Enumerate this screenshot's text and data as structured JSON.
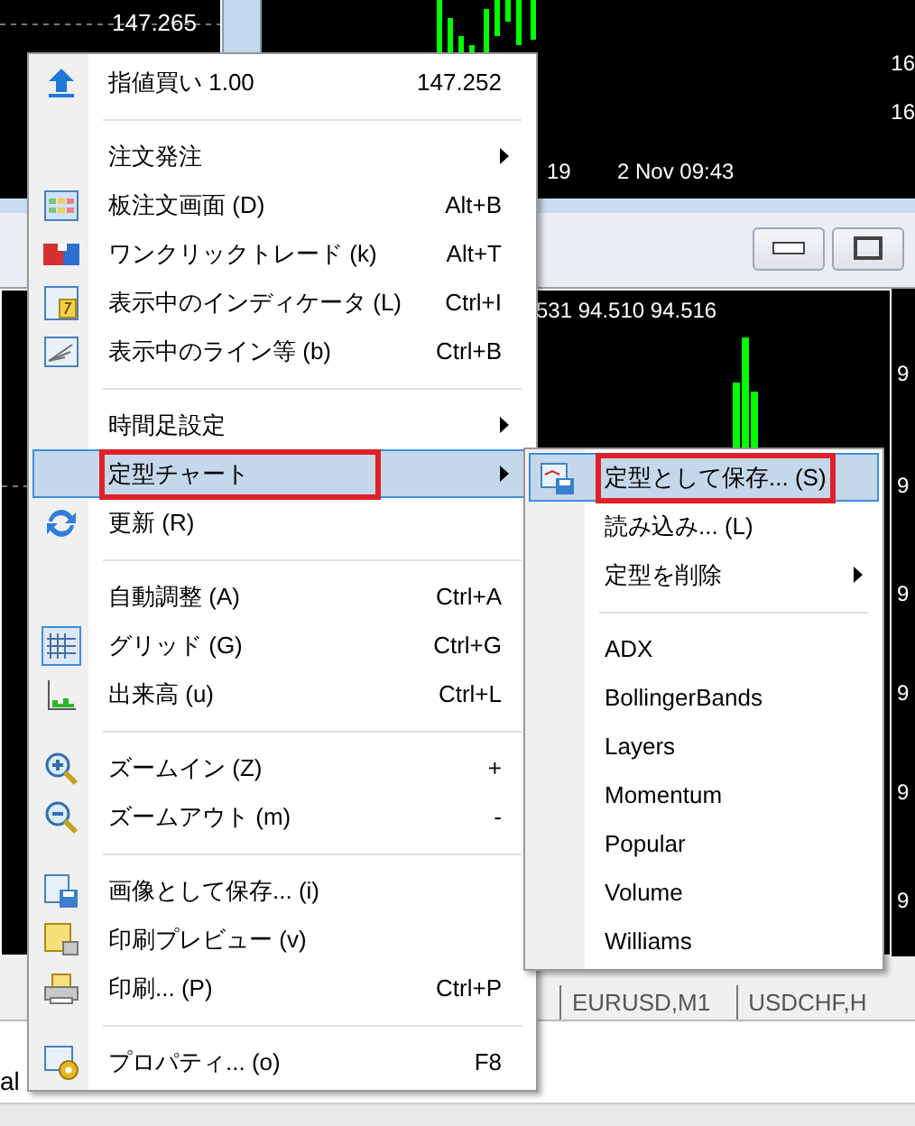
{
  "top_chart": {
    "price_label": "147.265",
    "time_labels": [
      "19",
      "2 Nov 09:43"
    ],
    "axis_labels": [
      "16",
      "16"
    ]
  },
  "lower_chart": {
    "header": "531 94.510 94.516",
    "axis_labels": [
      "9",
      "9",
      "9",
      "9",
      "9",
      "9"
    ]
  },
  "tabs": [
    {
      "label": "EURUSD,M1",
      "selected": false
    },
    {
      "label": "USDCHF,H",
      "selected": false
    }
  ],
  "status_text": "al",
  "context_menu": {
    "items": [
      {
        "kind": "item",
        "label": "指値買い 1.00",
        "shortcut": "147.252",
        "submenu": false,
        "selected": false,
        "checked": false,
        "highlighted": false
      },
      {
        "kind": "separator"
      },
      {
        "kind": "item",
        "label": "注文発注",
        "submenu": true,
        "selected": false,
        "checked": false,
        "highlighted": false
      },
      {
        "kind": "item",
        "label": "板注文画面 (D)",
        "shortcut": "Alt+B",
        "submenu": false,
        "selected": false,
        "checked": false,
        "highlighted": false
      },
      {
        "kind": "item",
        "label": "ワンクリックトレード (k)",
        "shortcut": "Alt+T",
        "submenu": false,
        "selected": false,
        "checked": false,
        "highlighted": false
      },
      {
        "kind": "item",
        "label": "表示中のインディケータ (L)",
        "shortcut": "Ctrl+I",
        "submenu": false,
        "selected": false,
        "checked": false,
        "highlighted": false
      },
      {
        "kind": "item",
        "label": "表示中のライン等 (b)",
        "shortcut": "Ctrl+B",
        "submenu": false,
        "selected": false,
        "checked": false,
        "highlighted": false
      },
      {
        "kind": "separator"
      },
      {
        "kind": "item",
        "label": "時間足設定",
        "submenu": true,
        "selected": false,
        "checked": false,
        "highlighted": false
      },
      {
        "kind": "item",
        "label": "定型チャート",
        "submenu": true,
        "selected": true,
        "checked": false,
        "highlighted": true
      },
      {
        "kind": "item",
        "label": "更新 (R)",
        "submenu": false,
        "selected": false,
        "checked": false,
        "highlighted": false
      },
      {
        "kind": "separator"
      },
      {
        "kind": "item",
        "label": "自動調整 (A)",
        "shortcut": "Ctrl+A",
        "submenu": false,
        "selected": false,
        "checked": false,
        "highlighted": false
      },
      {
        "kind": "item",
        "label": "グリッド (G)",
        "shortcut": "Ctrl+G",
        "submenu": false,
        "selected": false,
        "checked": true,
        "highlighted": false
      },
      {
        "kind": "item",
        "label": "出来高 (u)",
        "shortcut": "Ctrl+L",
        "submenu": false,
        "selected": false,
        "checked": false,
        "highlighted": false
      },
      {
        "kind": "separator"
      },
      {
        "kind": "item",
        "label": "ズームイン (Z)",
        "shortcut": "+",
        "submenu": false,
        "selected": false,
        "checked": false,
        "highlighted": false
      },
      {
        "kind": "item",
        "label": "ズームアウト (m)",
        "shortcut": "-",
        "submenu": false,
        "selected": false,
        "checked": false,
        "highlighted": false
      },
      {
        "kind": "separator"
      },
      {
        "kind": "item",
        "label": "画像として保存... (i)",
        "submenu": false,
        "selected": false,
        "checked": false,
        "highlighted": false
      },
      {
        "kind": "item",
        "label": "印刷プレビュー (v)",
        "submenu": false,
        "selected": false,
        "checked": false,
        "highlighted": false
      },
      {
        "kind": "item",
        "label": "印刷... (P)",
        "shortcut": "Ctrl+P",
        "submenu": false,
        "selected": false,
        "checked": false,
        "highlighted": false
      },
      {
        "kind": "separator"
      },
      {
        "kind": "item",
        "label": "プロパティ... (o)",
        "shortcut": "F8",
        "submenu": false,
        "selected": false,
        "checked": false,
        "highlighted": false
      }
    ]
  },
  "submenu": {
    "items": [
      {
        "kind": "item",
        "label": "定型として保存... (S)",
        "submenu": false,
        "selected": true,
        "highlighted": true
      },
      {
        "kind": "item",
        "label": "読み込み... (L)",
        "submenu": false,
        "selected": false,
        "highlighted": false
      },
      {
        "kind": "item",
        "label": "定型を削除",
        "submenu": true,
        "selected": false,
        "highlighted": false
      },
      {
        "kind": "separator"
      },
      {
        "kind": "item",
        "label": "ADX",
        "submenu": false,
        "selected": false,
        "highlighted": false
      },
      {
        "kind": "item",
        "label": "BollingerBands",
        "submenu": false,
        "selected": false,
        "highlighted": false
      },
      {
        "kind": "item",
        "label": "Layers",
        "submenu": false,
        "selected": false,
        "highlighted": false
      },
      {
        "kind": "item",
        "label": "Momentum",
        "submenu": false,
        "selected": false,
        "highlighted": false
      },
      {
        "kind": "item",
        "label": "Popular",
        "submenu": false,
        "selected": false,
        "highlighted": false
      },
      {
        "kind": "item",
        "label": "Volume",
        "submenu": false,
        "selected": false,
        "highlighted": false
      },
      {
        "kind": "item",
        "label": "Williams",
        "submenu": false,
        "selected": false,
        "highlighted": false
      }
    ]
  }
}
